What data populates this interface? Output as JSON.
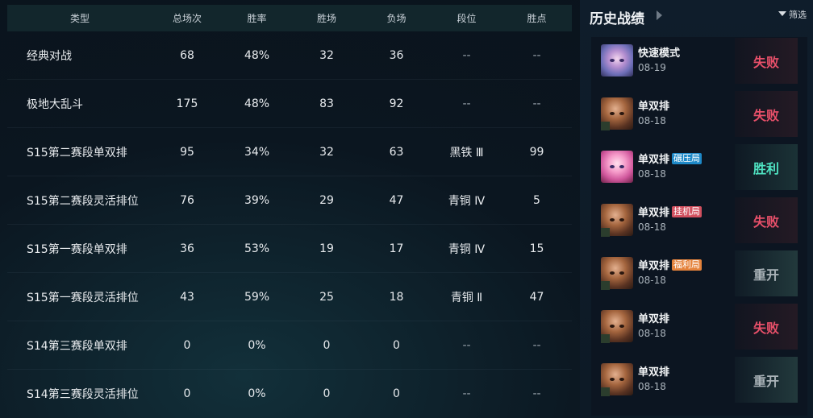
{
  "stats": {
    "headers": {
      "type": "类型",
      "total": "总场次",
      "rate": "胜率",
      "wins": "胜场",
      "losses": "负场",
      "rank": "段位",
      "points": "胜点"
    },
    "rows": [
      {
        "type": "经典对战",
        "total": "68",
        "rate": "48%",
        "wins": "32",
        "losses": "36",
        "rank": "--",
        "points": "--"
      },
      {
        "type": "极地大乱斗",
        "total": "175",
        "rate": "48%",
        "wins": "83",
        "losses": "92",
        "rank": "--",
        "points": "--"
      },
      {
        "type": "S15第二赛段单双排",
        "total": "95",
        "rate": "34%",
        "wins": "32",
        "losses": "63",
        "rank": "黑铁 Ⅲ",
        "points": "99"
      },
      {
        "type": "S15第二赛段灵活排位",
        "total": "76",
        "rate": "39%",
        "wins": "29",
        "losses": "47",
        "rank": "青铜 Ⅳ",
        "points": "5"
      },
      {
        "type": "S15第一赛段单双排",
        "total": "36",
        "rate": "53%",
        "wins": "19",
        "losses": "17",
        "rank": "青铜 Ⅳ",
        "points": "15"
      },
      {
        "type": "S15第一赛段灵活排位",
        "total": "43",
        "rate": "59%",
        "wins": "25",
        "losses": "18",
        "rank": "青铜 Ⅱ",
        "points": "47"
      },
      {
        "type": "S14第三赛段单双排",
        "total": "0",
        "rate": "0%",
        "wins": "0",
        "losses": "0",
        "rank": "--",
        "points": "--"
      },
      {
        "type": "S14第三赛段灵活排位",
        "total": "0",
        "rate": "0%",
        "wins": "0",
        "losses": "0",
        "rank": "--",
        "points": "--"
      }
    ]
  },
  "history": {
    "title": "历史战绩",
    "filter_label": "筛选",
    "matches": [
      {
        "mode": "快速模式",
        "tag": "",
        "date": "08-19",
        "result": "失败",
        "champ": "cat-icon"
      },
      {
        "mode": "单双排",
        "tag": "",
        "date": "08-18",
        "result": "失败",
        "champ": "champion-icon"
      },
      {
        "mode": "单双排",
        "tag": "碾压局",
        "date": "08-18",
        "result": "胜利",
        "champ": "pink-champion-icon"
      },
      {
        "mode": "单双排",
        "tag": "挂机局",
        "date": "08-18",
        "result": "失败",
        "champ": "champion-icon"
      },
      {
        "mode": "单双排",
        "tag": "福利局",
        "date": "08-18",
        "result": "重开",
        "champ": "champion-icon"
      },
      {
        "mode": "单双排",
        "tag": "",
        "date": "08-18",
        "result": "失败",
        "champ": "champion-icon"
      },
      {
        "mode": "单双排",
        "tag": "",
        "date": "08-18",
        "result": "重开",
        "champ": "champion-icon"
      }
    ]
  },
  "colors": {
    "loss": "#e8506a",
    "win": "#4fe3c2",
    "remake": "#aab3b8",
    "tag_blue": "#1e89c8",
    "tag_red": "#d2505f",
    "tag_orange": "#e5833c"
  }
}
